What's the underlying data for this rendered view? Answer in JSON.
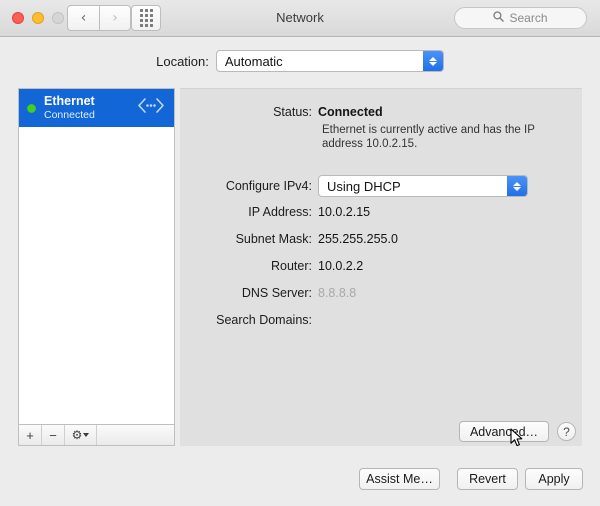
{
  "window": {
    "title": "Network",
    "traffic_lights": [
      "close-button",
      "minimize-button",
      "zoom-button"
    ],
    "nav": {
      "back_icon": "chevron-left-icon",
      "forward_icon": "chevron-right-icon"
    },
    "show_all_icon": "grid-icon",
    "search": {
      "placeholder": "Search",
      "icon": "search-icon",
      "value": ""
    }
  },
  "location": {
    "label": "Location:",
    "value": "Automatic",
    "options": [
      "Automatic"
    ]
  },
  "sidebar": {
    "services": [
      {
        "name": "Ethernet",
        "status": "Connected",
        "status_color": "#3fd028",
        "icon": "ethernet-icon",
        "selected": true
      }
    ],
    "toolbar": {
      "add_label": "+",
      "remove_label": "−",
      "action_icon": "gear-icon"
    }
  },
  "detail": {
    "status": {
      "label": "Status:",
      "value": "Connected",
      "description": "Ethernet is currently active and has the IP address 10.0.2.15."
    },
    "configure_ipv4": {
      "label": "Configure IPv4:",
      "value": "Using DHCP",
      "options": [
        "Using DHCP"
      ]
    },
    "fields": [
      {
        "label": "IP Address:",
        "value": "10.0.2.15",
        "dim": false
      },
      {
        "label": "Subnet Mask:",
        "value": "255.255.255.0",
        "dim": false
      },
      {
        "label": "Router:",
        "value": "10.0.2.2",
        "dim": false
      },
      {
        "label": "DNS Server:",
        "value": "8.8.8.8",
        "dim": true
      },
      {
        "label": "Search Domains:",
        "value": "",
        "dim": false
      }
    ],
    "advanced_label": "Advanced…",
    "help_label": "?"
  },
  "footer": {
    "assist_label": "Assist Me…",
    "revert_label": "Revert",
    "apply_label": "Apply"
  },
  "colors": {
    "selection_blue": "#1266d6",
    "stepper_blue": "#2f7cf6",
    "status_green": "#3fd028",
    "window_bg": "#ececec",
    "detail_bg": "#e0e0e0"
  }
}
